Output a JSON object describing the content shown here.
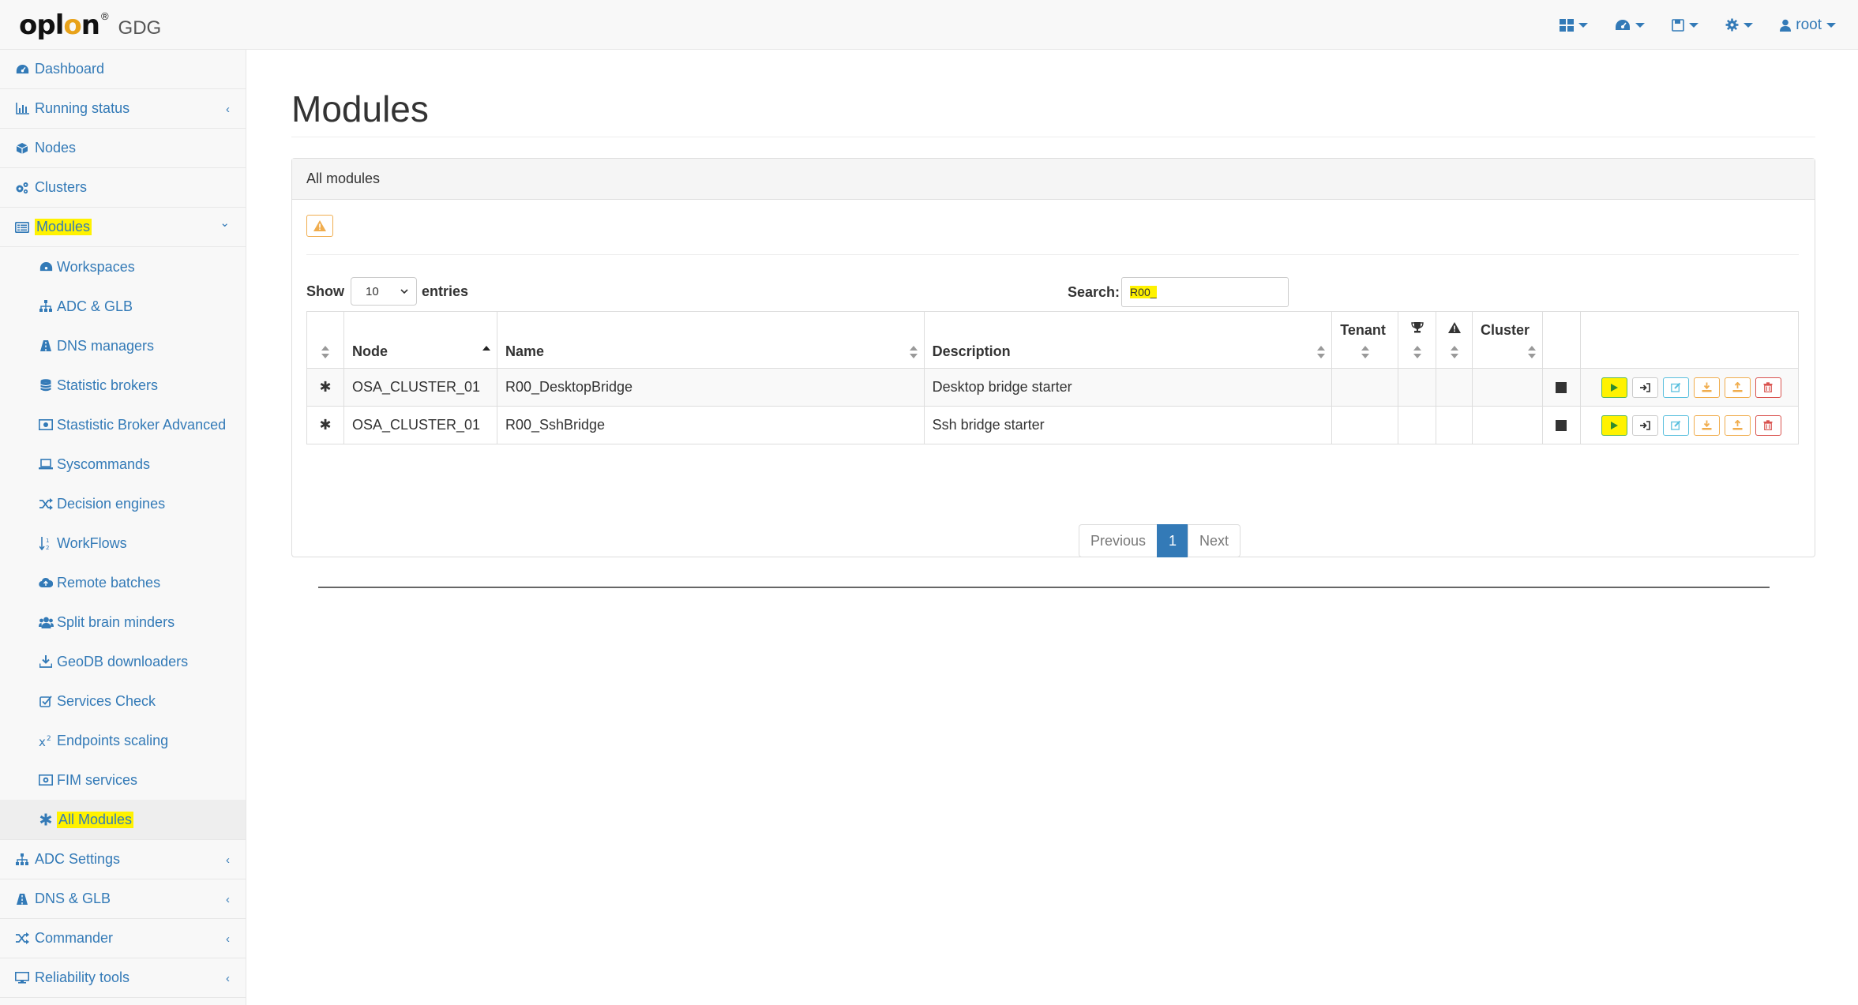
{
  "brand": {
    "logo": "oplon",
    "reg": "®",
    "product": "GDG"
  },
  "navbar": {
    "user_label": "root",
    "icons": [
      "grid-icon",
      "dashboard-icon",
      "save-icon",
      "gear-icon",
      "user-icon"
    ]
  },
  "sidebar": {
    "items": [
      {
        "label": "Dashboard",
        "icon": "dashboard-icon"
      },
      {
        "label": "Running status",
        "icon": "bar-chart-icon",
        "chevron": "‹"
      },
      {
        "label": "Nodes",
        "icon": "cube-icon"
      },
      {
        "label": "Clusters",
        "icon": "cogs-icon"
      },
      {
        "label": "Modules",
        "icon": "list-icon",
        "chevron": "⌄"
      }
    ],
    "subitems": [
      {
        "label": "Workspaces",
        "icon": "dashboard-icon"
      },
      {
        "label": "ADC & GLB",
        "icon": "sitemap-icon"
      },
      {
        "label": "DNS managers",
        "icon": "road-icon"
      },
      {
        "label": "Statistic brokers",
        "icon": "database-icon"
      },
      {
        "label": "Stastistic Broker Advanced",
        "icon": "money-icon"
      },
      {
        "label": "Syscommands",
        "icon": "laptop-icon"
      },
      {
        "label": "Decision engines",
        "icon": "random-icon"
      },
      {
        "label": "WorkFlows",
        "icon": "sort-numeric-icon"
      },
      {
        "label": "Remote batches",
        "icon": "cloud-upload-icon"
      },
      {
        "label": "Split brain minders",
        "icon": "users-icon"
      },
      {
        "label": "GeoDB downloaders",
        "icon": "download-icon"
      },
      {
        "label": "Services Check",
        "icon": "check-square-icon"
      },
      {
        "label": "Endpoints scaling",
        "icon": "superscript-icon"
      },
      {
        "label": "FIM services",
        "icon": "camera-icon"
      },
      {
        "label": "All Modules",
        "icon": "asterisk-icon"
      }
    ],
    "bottom_items": [
      {
        "label": "ADC Settings",
        "icon": "sitemap-icon",
        "chevron": "‹"
      },
      {
        "label": "DNS & GLB",
        "icon": "road-icon",
        "chevron": "‹"
      },
      {
        "label": "Commander",
        "icon": "random-icon",
        "chevron": "‹"
      },
      {
        "label": "Reliability tools",
        "icon": "desktop-icon",
        "chevron": "‹"
      }
    ]
  },
  "main": {
    "title": "Modules",
    "panel_title": "All modules",
    "show_label": "Show",
    "entries_value": "10",
    "entries_label": "entries",
    "search_label": "Search:",
    "search_value": "R00_",
    "table": {
      "headers": [
        "",
        "Node",
        "Name",
        "Description",
        "Tenant",
        "",
        "",
        "Cluster",
        "",
        ""
      ],
      "rows": [
        {
          "marker": "✱",
          "node": "OSA_CLUSTER_01",
          "name": "R00_DesktopBridge",
          "description": "Desktop bridge starter",
          "tenant": "",
          "trophy": "",
          "warning": "",
          "cluster": ""
        },
        {
          "marker": "✱",
          "node": "OSA_CLUSTER_01",
          "name": "R00_SshBridge",
          "description": "Ssh bridge starter",
          "tenant": "",
          "trophy": "",
          "warning": "",
          "cluster": ""
        }
      ]
    },
    "pagination": {
      "previous": "Previous",
      "current": "1",
      "next": "Next"
    }
  },
  "colors": {
    "link": "#337ab7",
    "highlight": "#fff200",
    "warning": "#f0ad4e",
    "danger": "#d9534f",
    "info": "#5bc0de",
    "success": "#5cb85c"
  }
}
